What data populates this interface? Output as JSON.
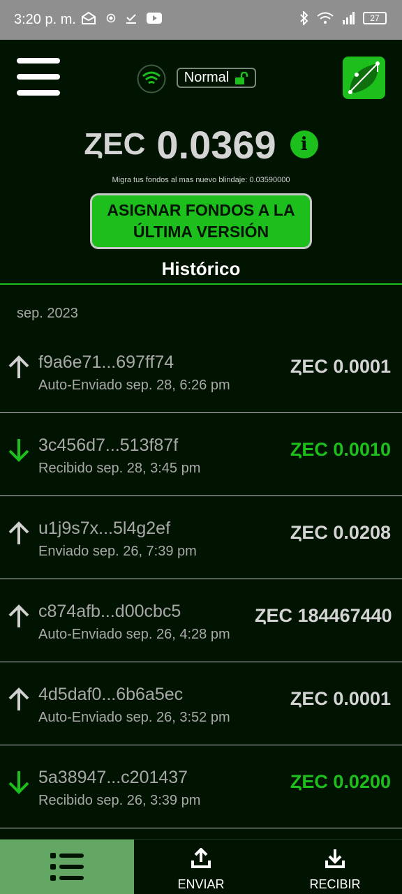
{
  "status_bar": {
    "time": "3:20 p. m.",
    "battery": "27"
  },
  "header": {
    "mode_label": "Normal"
  },
  "balance": {
    "currency": "ȤEC",
    "amount": "0.0369"
  },
  "migrate_text": "Migra tus fondos al mas nuevo blindaje:  0.03590000",
  "assign_button": "ASIGNAR FONDOS A LA ÚLTIMA VERSIÓN",
  "history_title": "Histórico",
  "month_label": "sep. 2023",
  "transactions": [
    {
      "id": "f9a6e71...697ff74",
      "meta": "Auto-Enviado sep. 28, 6:26 pm",
      "amount": "ȤEC 0.0001",
      "direction": "out"
    },
    {
      "id": "3c456d7...513f87f",
      "meta": "Recibido sep. 28, 3:45 pm",
      "amount": "ȤEC 0.0010",
      "direction": "in"
    },
    {
      "id": "u1j9s7x...5l4g2ef",
      "meta": "Enviado sep. 26, 7:39 pm",
      "amount": "ȤEC 0.0208",
      "direction": "out"
    },
    {
      "id": "c874afb...d00cbc5",
      "meta": "Auto-Enviado sep. 26, 4:28 pm",
      "amount": "ȤEC 184467440",
      "direction": "out"
    },
    {
      "id": "4d5daf0...6b6a5ec",
      "meta": "Auto-Enviado sep. 26, 3:52 pm",
      "amount": "ȤEC 0.0001",
      "direction": "out"
    },
    {
      "id": "5a38947...c201437",
      "meta": "Recibido sep. 26, 3:39 pm",
      "amount": "ȤEC 0.0200",
      "direction": "in"
    }
  ],
  "tabs": {
    "send": "ENVIAR",
    "receive": "RECIBIR"
  },
  "colors": {
    "background": "#011401",
    "accent": "#1dbf1d",
    "status_bar": "#8f8f8f",
    "active_tab": "#64a664"
  },
  "icons": [
    "menu-icon",
    "wifi-icon",
    "unlock-icon",
    "app-logo",
    "info-icon",
    "arrow-up-icon",
    "arrow-down-icon",
    "list-icon",
    "upload-icon",
    "download-icon"
  ]
}
